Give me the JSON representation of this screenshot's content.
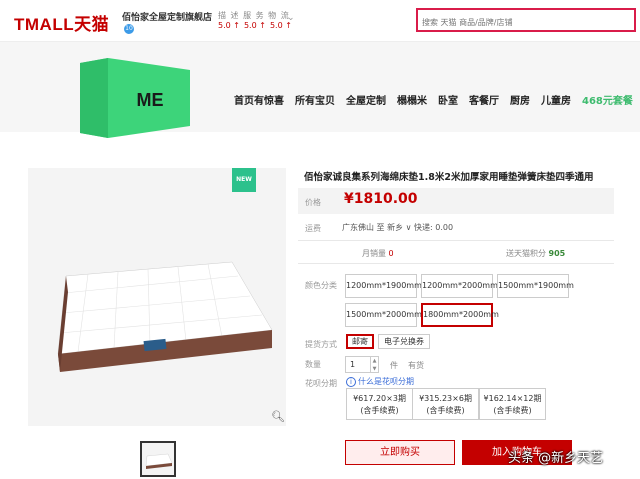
{
  "header": {
    "logo_text": "TMALL天猫",
    "shop_name": "佰怡家全屋定制旗舰店",
    "shop_badge": "10",
    "ratings_label": "描 述  服 务  物 流",
    "ratings": [
      "5.0 ↑",
      "5.0 ↑",
      "5.0 ↑"
    ],
    "search_placeholder": "搜索 天猫 商品/品牌/店铺"
  },
  "store_nav": {
    "logo_text": "ME",
    "items": [
      "首页有惊喜",
      "所有宝贝",
      "全屋定制",
      "榻榻米",
      "卧室",
      "客餐厅",
      "厨房",
      "儿童房",
      "468元套餐"
    ],
    "accent": "#3dbb6e"
  },
  "gallery": {
    "new_badge": "NEW",
    "zoom_icon": "magnifier-icon"
  },
  "product": {
    "title": "佰怡家诚良集系列海绵床垫1.8米2米加厚家用睡垫弹簧床垫四季通用",
    "price_label": "价格",
    "price": "¥1810.00",
    "ship_label": "运费",
    "ship_text": "广东佛山  至 新乡 ∨  快递: 0.00",
    "sold_label": "月销量",
    "sold_value": "0",
    "points_label": "送天猫积分",
    "points_value": "905",
    "color_label": "颜色分类",
    "color_options": [
      {
        "label": "1200mm*1900mm",
        "selected": false
      },
      {
        "label": "1200mm*2000mm",
        "selected": false
      },
      {
        "label": "1500mm*1900mm",
        "selected": false
      },
      {
        "label": "1500mm*2000mm",
        "selected": false
      },
      {
        "label": "1800mm*2000mm",
        "selected": true
      }
    ],
    "delivery_label": "提货方式",
    "delivery_options": [
      {
        "label": "邮寄",
        "selected": true
      },
      {
        "label": "电子兑换券",
        "selected": false
      }
    ],
    "qty_label": "数量",
    "qty": "1",
    "qty_unit": "件",
    "stock": "有货",
    "installment_label": "花呗分期",
    "installment_question": "什么是花呗分期",
    "plans": [
      {
        "amount": "¥617.20×3期",
        "note": "(含手续费)"
      },
      {
        "amount": "¥315.23×6期",
        "note": "(含手续费)"
      },
      {
        "amount": "¥162.14×12期",
        "note": "(含手续费)"
      }
    ],
    "buy_label": "立即购买",
    "cart_label": "加入购物车"
  },
  "watermark": "头条 @新乡天艺",
  "colors": {
    "brand_red": "#c40000",
    "search_border": "#d91c4a",
    "new_badge": "#2cc18c",
    "logo_green": "#3dd47a"
  }
}
